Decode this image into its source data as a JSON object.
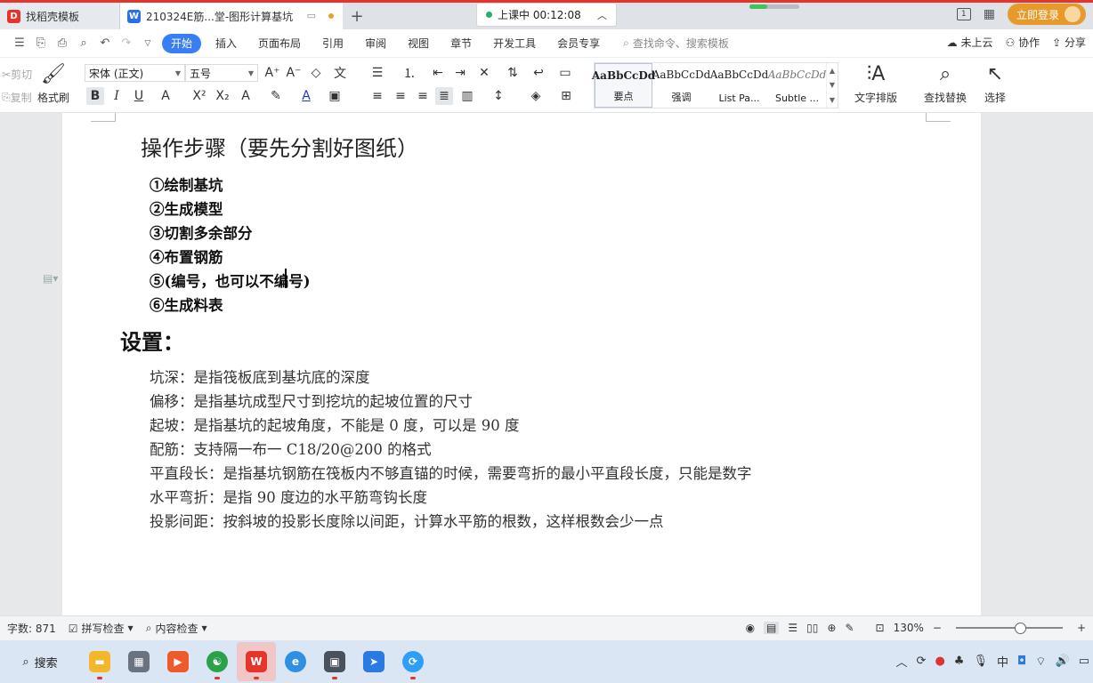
{
  "tabs": [
    {
      "label": "找稻壳模板",
      "icon": "daoke-icon",
      "color": "#e5342b"
    },
    {
      "label": "210324E筋...堂-图形计算基坑",
      "icon": "wps-writer-icon",
      "color": "#2a6ef0"
    }
  ],
  "class_status": {
    "label": "上课中 00:12:08"
  },
  "title_right": {
    "login": "立即登录"
  },
  "menu": {
    "items": [
      "开始",
      "插入",
      "页面布局",
      "引用",
      "审阅",
      "视图",
      "章节",
      "开发工具",
      "会员专享"
    ],
    "search": "查找命令、搜索模板",
    "right": [
      "未上云",
      "协作",
      "分享"
    ]
  },
  "ribbon": {
    "cut": "剪切",
    "copy": "复制",
    "format_painter": "格式刷",
    "font_name": "宋体 (正文)",
    "font_size": "五号",
    "styles": [
      {
        "preview": "AaBbCcDd",
        "label": "要点"
      },
      {
        "preview": "AaBbCcDd",
        "label": "强调"
      },
      {
        "preview": "AaBbCcDd",
        "label": "List Pa..."
      },
      {
        "preview": "AaBbCcDd",
        "label": "Subtle ..."
      }
    ],
    "text_layout": "文字排版",
    "find_replace": "查找替换",
    "select": "选择"
  },
  "document": {
    "title": "操作步骤（要先分割好图纸）",
    "steps": [
      "①绘制基坑",
      "②生成模型",
      "③切割多余部分",
      "④布置钢筋",
      "⑤(编号，也可以不编号)",
      "⑥生成料表"
    ],
    "settings_heading": "设置：",
    "settings": [
      "坑深：是指筏板底到基坑底的深度",
      "偏移：是指基坑成型尺寸到挖坑的起坡位置的尺寸",
      "起坡：是指基坑的起坡角度，不能是 0 度，可以是 90 度",
      "配筋：支持隔一布一 C18/20@200 的格式",
      "平直段长：是指基坑钢筋在筏板内不够直锚的时候，需要弯折的最小平直段长度，只能是数字",
      "水平弯折：是指 90 度边的水平筋弯钩长度",
      "投影间距：按斜坡的投影长度除以间距，计算水平筋的根数，这样根数会少一点"
    ]
  },
  "status": {
    "word_count": "字数: 871",
    "spell_check": "拼写检查",
    "content_check": "内容检查",
    "zoom": "130%"
  },
  "taskbar": {
    "search": "搜索"
  }
}
